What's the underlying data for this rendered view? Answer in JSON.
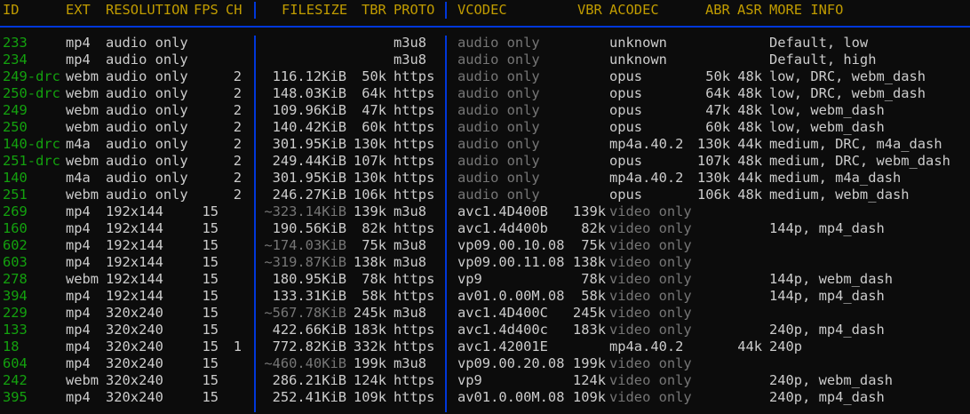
{
  "header": {
    "id": "ID",
    "ext": "EXT",
    "resolution": "RESOLUTION",
    "fps": "FPS",
    "ch": "CH",
    "filesize": "FILESIZE",
    "tbr": "TBR",
    "proto": "PROTO",
    "vcodec": "VCODEC",
    "vbr": "VBR",
    "acodec": "ACODEC",
    "abr": "ABR",
    "asr": "ASR",
    "more_info": "MORE INFO"
  },
  "rows": [
    {
      "id": "233",
      "ext": "mp4",
      "res": "audio only",
      "fps": "",
      "ch": "",
      "filesize": "",
      "tbr": "",
      "proto": "m3u8",
      "vcodec": "audio only",
      "vbr": "",
      "acodec": "unknown",
      "abr": "",
      "asr": "",
      "info": "Default, low"
    },
    {
      "id": "234",
      "ext": "mp4",
      "res": "audio only",
      "fps": "",
      "ch": "",
      "filesize": "",
      "tbr": "",
      "proto": "m3u8",
      "vcodec": "audio only",
      "vbr": "",
      "acodec": "unknown",
      "abr": "",
      "asr": "",
      "info": "Default, high"
    },
    {
      "id": "249-drc",
      "ext": "webm",
      "res": "audio only",
      "fps": "",
      "ch": "2",
      "filesize": "116.12KiB",
      "tbr": "50k",
      "proto": "https",
      "vcodec": "audio only",
      "vbr": "",
      "acodec": "opus",
      "abr": "50k",
      "asr": "48k",
      "info": "low, DRC, webm_dash"
    },
    {
      "id": "250-drc",
      "ext": "webm",
      "res": "audio only",
      "fps": "",
      "ch": "2",
      "filesize": "148.03KiB",
      "tbr": "64k",
      "proto": "https",
      "vcodec": "audio only",
      "vbr": "",
      "acodec": "opus",
      "abr": "64k",
      "asr": "48k",
      "info": "low, DRC, webm_dash"
    },
    {
      "id": "249",
      "ext": "webm",
      "res": "audio only",
      "fps": "",
      "ch": "2",
      "filesize": "109.96KiB",
      "tbr": "47k",
      "proto": "https",
      "vcodec": "audio only",
      "vbr": "",
      "acodec": "opus",
      "abr": "47k",
      "asr": "48k",
      "info": "low, webm_dash"
    },
    {
      "id": "250",
      "ext": "webm",
      "res": "audio only",
      "fps": "",
      "ch": "2",
      "filesize": "140.42KiB",
      "tbr": "60k",
      "proto": "https",
      "vcodec": "audio only",
      "vbr": "",
      "acodec": "opus",
      "abr": "60k",
      "asr": "48k",
      "info": "low, webm_dash"
    },
    {
      "id": "140-drc",
      "ext": "m4a",
      "res": "audio only",
      "fps": "",
      "ch": "2",
      "filesize": "301.95KiB",
      "tbr": "130k",
      "proto": "https",
      "vcodec": "audio only",
      "vbr": "",
      "acodec": "mp4a.40.2",
      "abr": "130k",
      "asr": "44k",
      "info": "medium, DRC, m4a_dash"
    },
    {
      "id": "251-drc",
      "ext": "webm",
      "res": "audio only",
      "fps": "",
      "ch": "2",
      "filesize": "249.44KiB",
      "tbr": "107k",
      "proto": "https",
      "vcodec": "audio only",
      "vbr": "",
      "acodec": "opus",
      "abr": "107k",
      "asr": "48k",
      "info": "medium, DRC, webm_dash"
    },
    {
      "id": "140",
      "ext": "m4a",
      "res": "audio only",
      "fps": "",
      "ch": "2",
      "filesize": "301.95KiB",
      "tbr": "130k",
      "proto": "https",
      "vcodec": "audio only",
      "vbr": "",
      "acodec": "mp4a.40.2",
      "abr": "130k",
      "asr": "44k",
      "info": "medium, m4a_dash"
    },
    {
      "id": "251",
      "ext": "webm",
      "res": "audio only",
      "fps": "",
      "ch": "2",
      "filesize": "246.27KiB",
      "tbr": "106k",
      "proto": "https",
      "vcodec": "audio only",
      "vbr": "",
      "acodec": "opus",
      "abr": "106k",
      "asr": "48k",
      "info": "medium, webm_dash"
    },
    {
      "id": "269",
      "ext": "mp4",
      "res": "192x144",
      "fps": "15",
      "ch": "",
      "filesize": "~323.14KiB",
      "tbr": "139k",
      "proto": "m3u8",
      "vcodec": "avc1.4D400B",
      "vbr": "139k",
      "acodec": "video only",
      "abr": "",
      "asr": "",
      "info": ""
    },
    {
      "id": "160",
      "ext": "mp4",
      "res": "192x144",
      "fps": "15",
      "ch": "",
      "filesize": "190.56KiB",
      "tbr": "82k",
      "proto": "https",
      "vcodec": "avc1.4d400b",
      "vbr": "82k",
      "acodec": "video only",
      "abr": "",
      "asr": "",
      "info": "144p, mp4_dash"
    },
    {
      "id": "602",
      "ext": "mp4",
      "res": "192x144",
      "fps": "15",
      "ch": "",
      "filesize": "~174.03KiB",
      "tbr": "75k",
      "proto": "m3u8",
      "vcodec": "vp09.00.10.08",
      "vbr": "75k",
      "acodec": "video only",
      "abr": "",
      "asr": "",
      "info": ""
    },
    {
      "id": "603",
      "ext": "mp4",
      "res": "192x144",
      "fps": "15",
      "ch": "",
      "filesize": "~319.87KiB",
      "tbr": "138k",
      "proto": "m3u8",
      "vcodec": "vp09.00.11.08",
      "vbr": "138k",
      "acodec": "video only",
      "abr": "",
      "asr": "",
      "info": ""
    },
    {
      "id": "278",
      "ext": "webm",
      "res": "192x144",
      "fps": "15",
      "ch": "",
      "filesize": "180.95KiB",
      "tbr": "78k",
      "proto": "https",
      "vcodec": "vp9",
      "vbr": "78k",
      "acodec": "video only",
      "abr": "",
      "asr": "",
      "info": "144p, webm_dash"
    },
    {
      "id": "394",
      "ext": "mp4",
      "res": "192x144",
      "fps": "15",
      "ch": "",
      "filesize": "133.31KiB",
      "tbr": "58k",
      "proto": "https",
      "vcodec": "av01.0.00M.08",
      "vbr": "58k",
      "acodec": "video only",
      "abr": "",
      "asr": "",
      "info": "144p, mp4_dash"
    },
    {
      "id": "229",
      "ext": "mp4",
      "res": "320x240",
      "fps": "15",
      "ch": "",
      "filesize": "~567.78KiB",
      "tbr": "245k",
      "proto": "m3u8",
      "vcodec": "avc1.4D400C",
      "vbr": "245k",
      "acodec": "video only",
      "abr": "",
      "asr": "",
      "info": ""
    },
    {
      "id": "133",
      "ext": "mp4",
      "res": "320x240",
      "fps": "15",
      "ch": "",
      "filesize": "422.66KiB",
      "tbr": "183k",
      "proto": "https",
      "vcodec": "avc1.4d400c",
      "vbr": "183k",
      "acodec": "video only",
      "abr": "",
      "asr": "",
      "info": "240p, mp4_dash"
    },
    {
      "id": "18",
      "ext": "mp4",
      "res": "320x240",
      "fps": "15",
      "ch": "1",
      "filesize": "772.82KiB",
      "tbr": "332k",
      "proto": "https",
      "vcodec": "avc1.42001E",
      "vbr": "",
      "acodec": "mp4a.40.2",
      "abr": "",
      "asr": "44k",
      "info": "240p"
    },
    {
      "id": "604",
      "ext": "mp4",
      "res": "320x240",
      "fps": "15",
      "ch": "",
      "filesize": "~460.40KiB",
      "tbr": "199k",
      "proto": "m3u8",
      "vcodec": "vp09.00.20.08",
      "vbr": "199k",
      "acodec": "video only",
      "abr": "",
      "asr": "",
      "info": ""
    },
    {
      "id": "242",
      "ext": "webm",
      "res": "320x240",
      "fps": "15",
      "ch": "",
      "filesize": "286.21KiB",
      "tbr": "124k",
      "proto": "https",
      "vcodec": "vp9",
      "vbr": "124k",
      "acodec": "video only",
      "abr": "",
      "asr": "",
      "info": "240p, webm_dash"
    },
    {
      "id": "395",
      "ext": "mp4",
      "res": "320x240",
      "fps": "15",
      "ch": "",
      "filesize": "252.41KiB",
      "tbr": "109k",
      "proto": "https",
      "vcodec": "av01.0.00M.08",
      "vbr": "109k",
      "acodec": "video only",
      "abr": "",
      "asr": "",
      "info": "240p, mp4_dash"
    }
  ]
}
